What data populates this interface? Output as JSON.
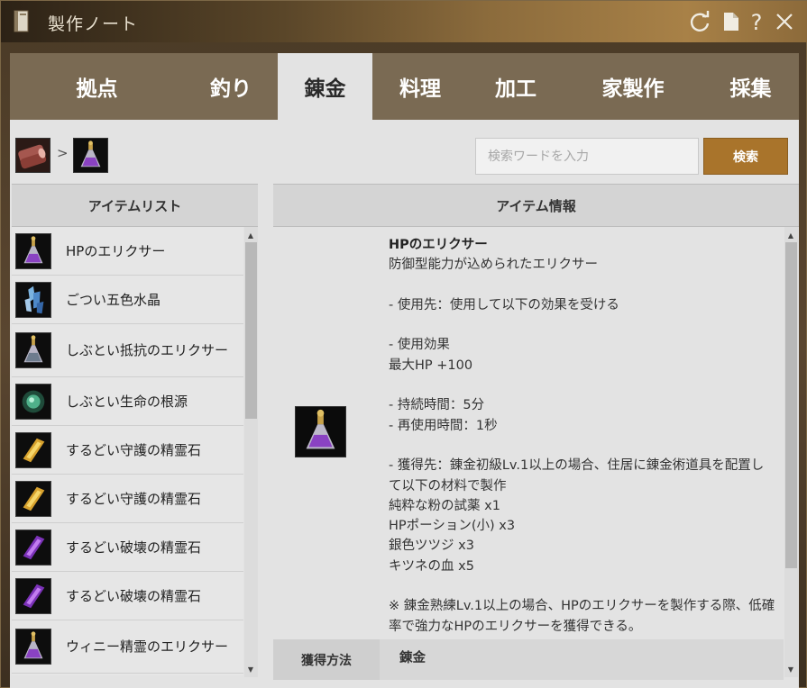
{
  "window": {
    "title": "製作ノート"
  },
  "tabs": [
    {
      "label": "拠点",
      "active": false
    },
    {
      "label": "釣り",
      "active": false
    },
    {
      "label": "錬金",
      "active": true
    },
    {
      "label": "料理",
      "active": false
    },
    {
      "label": "加工",
      "active": false
    },
    {
      "label": "家製作",
      "active": false
    },
    {
      "label": "採集",
      "active": false
    }
  ],
  "breadcrumb": {
    "separator": ">"
  },
  "search": {
    "placeholder": "検索ワードを入力",
    "value": "",
    "button_label": "検索"
  },
  "item_list": {
    "header": "アイテムリスト",
    "items": [
      {
        "label": "HPのエリクサー",
        "icon": "purple-elixir-icon"
      },
      {
        "label": "ごつい五色水晶",
        "icon": "crystal-icon"
      },
      {
        "label": "しぶとい抵抗のエリクサー",
        "icon": "grey-elixir-icon"
      },
      {
        "label": "しぶとい生命の根源",
        "icon": "green-orb-icon"
      },
      {
        "label": "するどい守護の精霊石",
        "icon": "gold-spirit-stone-icon"
      },
      {
        "label": "するどい守護の精霊石",
        "icon": "gold-spirit-stone-icon"
      },
      {
        "label": "するどい破壊の精霊石",
        "icon": "purple-spirit-stone-icon"
      },
      {
        "label": "するどい破壊の精霊石",
        "icon": "purple-spirit-stone-icon"
      },
      {
        "label": "ウィニー精霊のエリクサー",
        "icon": "purple-elixir-icon"
      }
    ]
  },
  "item_info": {
    "header": "アイテム情報",
    "name": "HPのエリクサー",
    "description": "防御型能力が込められたエリクサー",
    "usage": "- 使用先：使用して以下の効果を受ける",
    "effect_title": "- 使用効果",
    "effect": "最大HP +100",
    "duration": "- 持続時間：5分",
    "cooldown": "- 再使用時間：1秒",
    "acquisition": "- 獲得先：錬金初級Lv.1以上の場合、住居に錬金術道具を配置して以下の材料で製作",
    "materials": [
      "純粋な粉の試薬 x1",
      "HPポーション(小) x3",
      "銀色ツツジ x3",
      "キツネの血 x5"
    ],
    "note": "※ 錬金熟練Lv.1以上の場合、HPのエリクサーを製作する際、低確率で強力なHPのエリクサーを獲得できる。",
    "acquire_method_label": "獲得方法",
    "acquire_method_value": "錬金"
  },
  "colors": {
    "accent": "#a9742b",
    "tab_bar": "#7a6a53",
    "active_tab": "#e3e3e3"
  }
}
